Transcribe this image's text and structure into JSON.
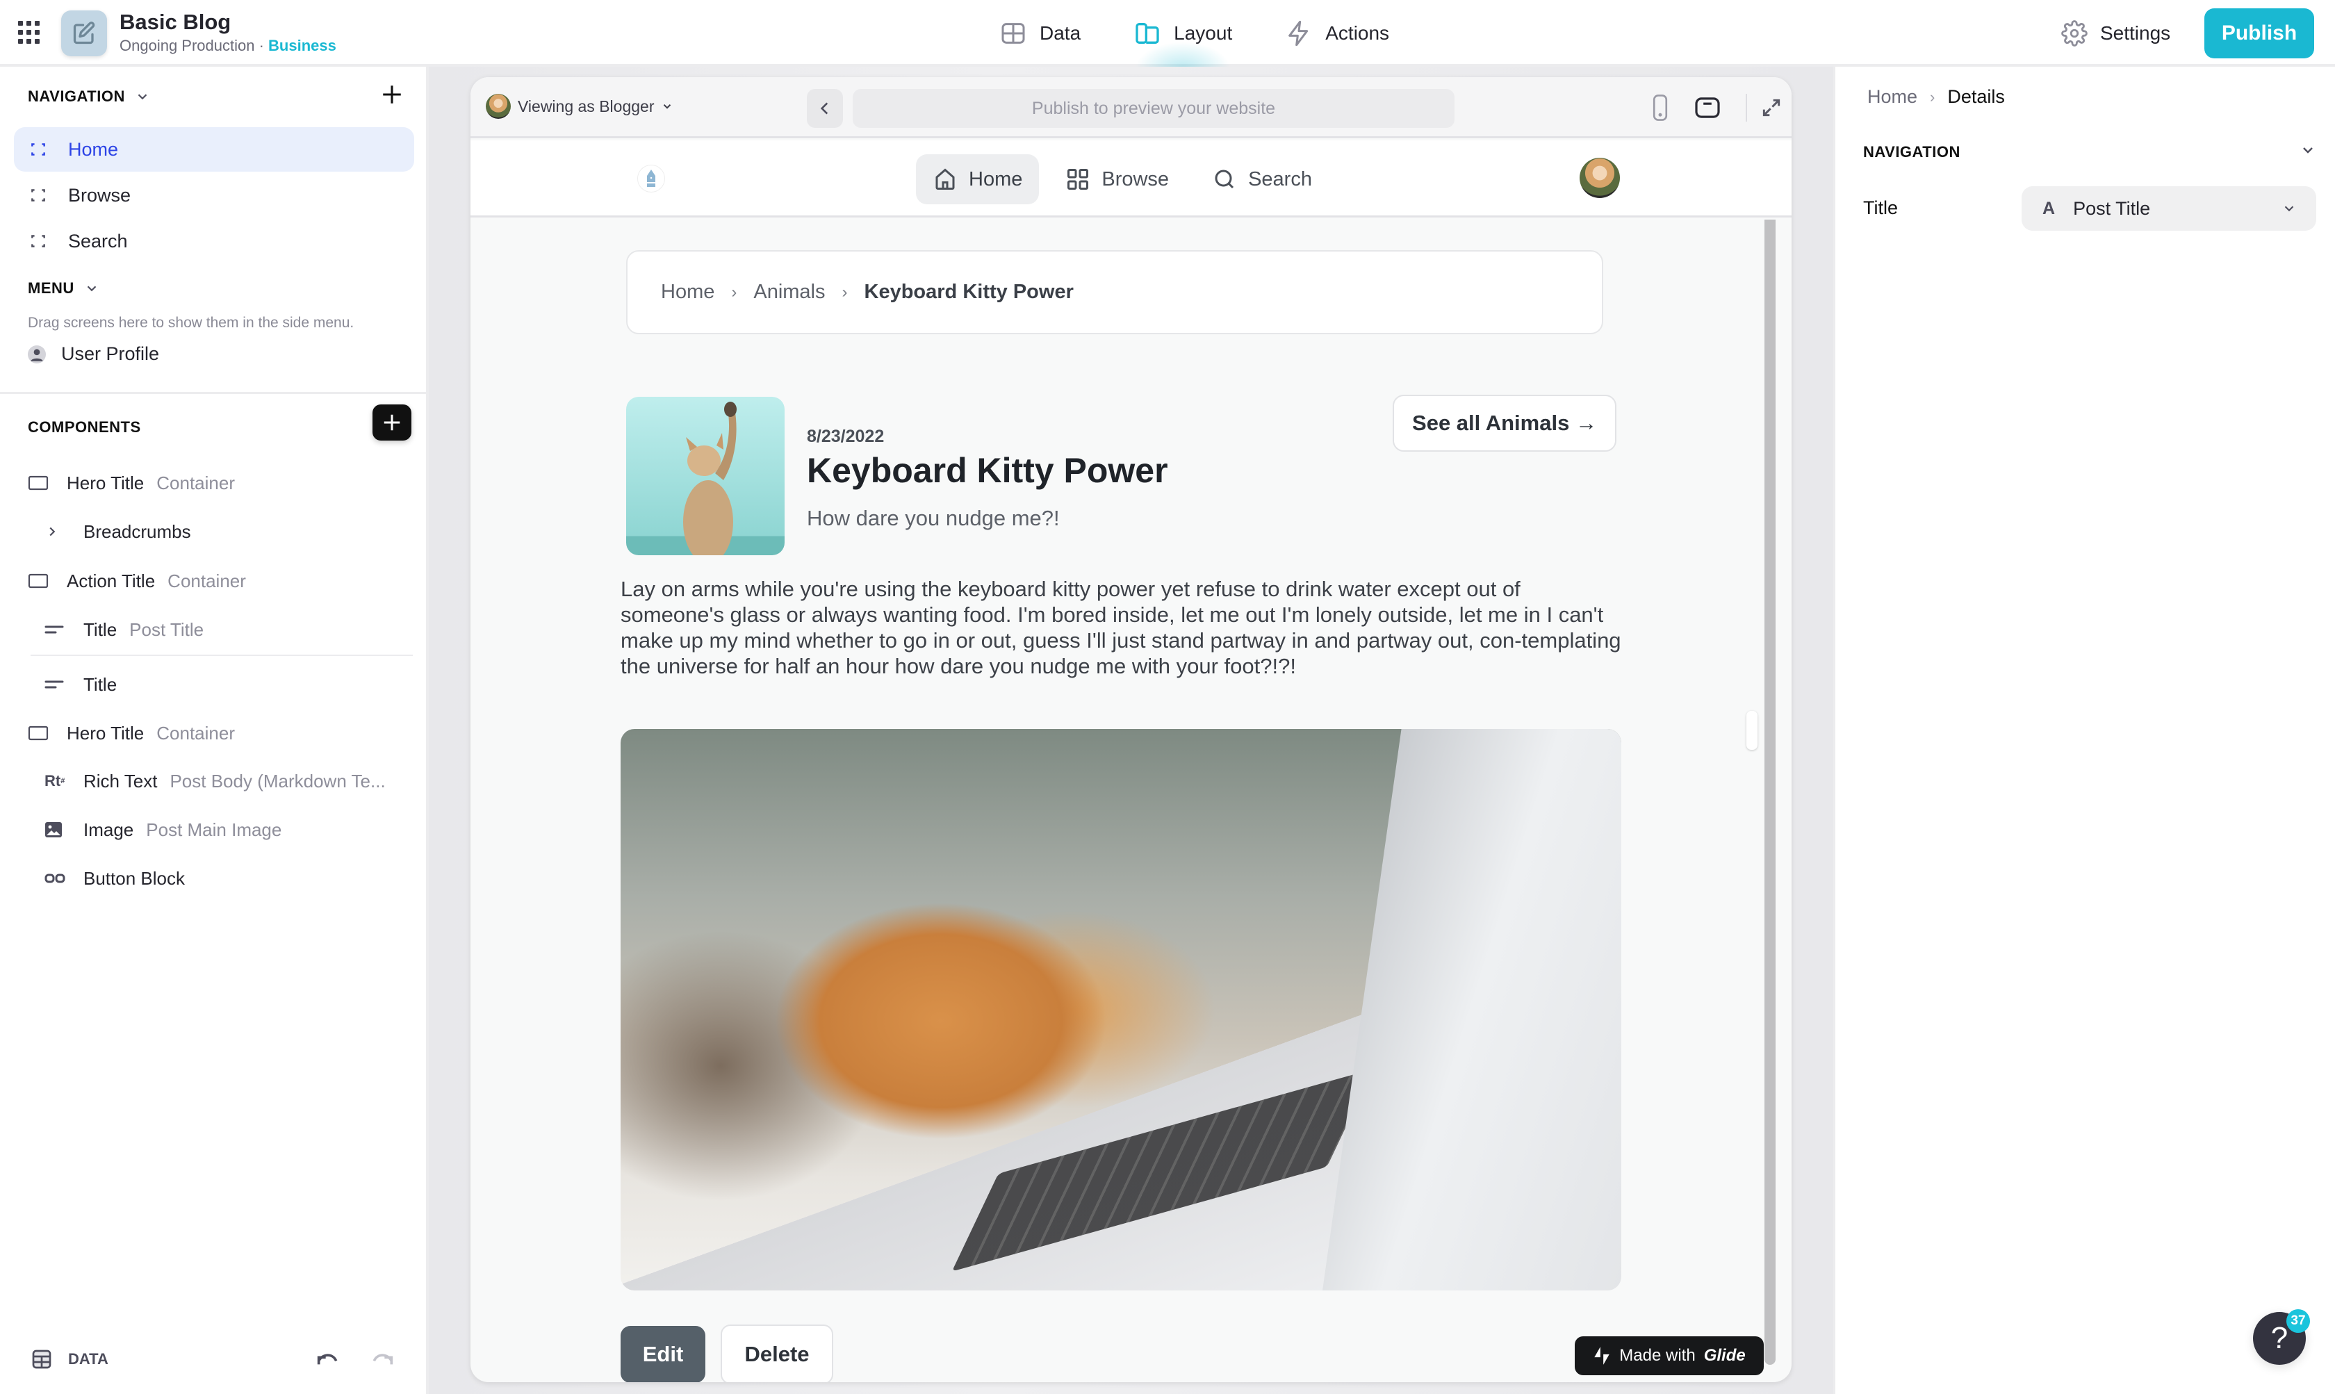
{
  "app": {
    "title": "Basic Blog",
    "subtitle": "Ongoing Production",
    "separator": "·",
    "plan": "Business",
    "accent_color": "#1ab8d2"
  },
  "topbar": {
    "tabs": [
      {
        "label": "Data",
        "icon": "table-icon"
      },
      {
        "label": "Layout",
        "icon": "layout-icon",
        "active": true
      },
      {
        "label": "Actions",
        "icon": "lightning-icon"
      }
    ],
    "settings_label": "Settings",
    "publish_label": "Publish"
  },
  "sidebar": {
    "navigation_header": "NAVIGATION",
    "navigation_items": [
      {
        "label": "Home",
        "active": true
      },
      {
        "label": "Browse"
      },
      {
        "label": "Search"
      }
    ],
    "menu_header": "MENU",
    "menu_hint": "Drag screens here to show them in the side menu.",
    "menu_items": [
      {
        "label": "User Profile"
      }
    ],
    "components_header": "COMPONENTS",
    "components": [
      {
        "label": "Hero Title",
        "sub": "Container",
        "icon": "container-icon",
        "indent": 0
      },
      {
        "label": "Breadcrumbs",
        "sub": "",
        "icon": "chevron-right-icon",
        "indent": 1
      },
      {
        "label": "Action Title",
        "sub": "Container",
        "icon": "container-icon",
        "indent": 0
      },
      {
        "label": "Title",
        "sub": "Post Title",
        "icon": "title-icon",
        "indent": 1
      },
      {
        "label": "Title",
        "sub": "",
        "icon": "title-icon",
        "indent": 1
      },
      {
        "label": "Hero Title",
        "sub": "Container",
        "icon": "container-icon",
        "indent": 0
      },
      {
        "label": "Rich Text",
        "sub": "Post Body (Markdown Te...",
        "icon": "rich-text-icon",
        "indent": 1
      },
      {
        "label": "Image",
        "sub": "Post Main Image",
        "icon": "image-icon",
        "indent": 1
      },
      {
        "label": "Button Block",
        "sub": "",
        "icon": "button-block-icon",
        "indent": 1
      }
    ],
    "data_label": "DATA"
  },
  "preview": {
    "viewing_as": "Viewing as Blogger",
    "url_placeholder": "Publish to preview your website",
    "app_tabs": [
      {
        "label": "Home",
        "icon": "home-icon",
        "active": true
      },
      {
        "label": "Browse",
        "icon": "grid-icon"
      },
      {
        "label": "Search",
        "icon": "search-icon"
      }
    ],
    "breadcrumb": [
      "Home",
      "Animals",
      "Keyboard Kitty Power"
    ],
    "post": {
      "date": "8/23/2022",
      "title": "Keyboard Kitty Power",
      "subtitle": "How dare you nudge me?!",
      "see_all_label": "See all Animals →",
      "body": "Lay on arms while you're using the keyboard kitty power yet refuse to drink water except out of someone's glass or always wanting food. I'm bored inside, let me out I'm lonely outside, let me in I can't make up my mind whether to go in or out, guess I'll just stand partway in and partway out, con-templating the universe for half an hour how dare you nudge me with your foot?!?!"
    },
    "edit_label": "Edit",
    "delete_label": "Delete",
    "made_with_prefix": "Made with",
    "made_with_brand": "Glide"
  },
  "right_panel": {
    "breadcrumb_home": "Home",
    "breadcrumb_current": "Details",
    "section_header": "NAVIGATION",
    "title_label": "Title",
    "title_value": "Post Title"
  },
  "help": {
    "icon": "?",
    "badge_count": "37"
  }
}
